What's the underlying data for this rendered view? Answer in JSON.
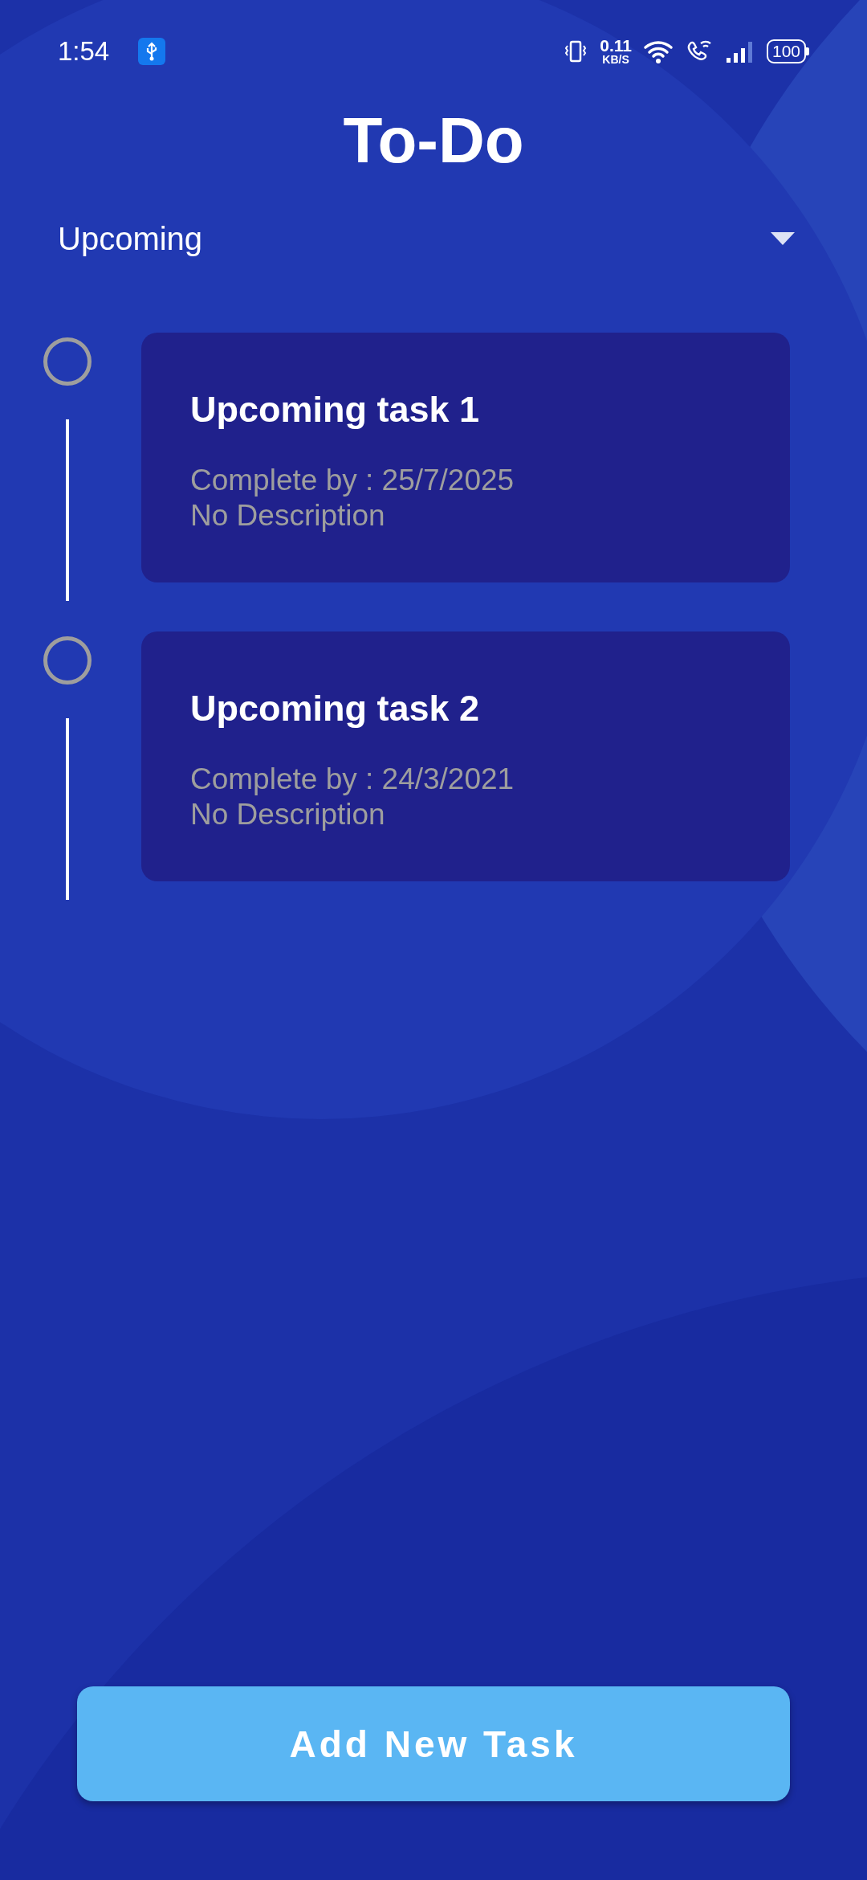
{
  "status_bar": {
    "time": "1:54",
    "net_speed": "0.11",
    "net_unit": "KB/S",
    "battery": "100"
  },
  "title": "To-Do",
  "filter": {
    "label": "Upcoming"
  },
  "tasks": [
    {
      "title": "Upcoming task 1",
      "due": "Complete by : 25/7/2025",
      "description": "No Description",
      "completed": false
    },
    {
      "title": "Upcoming task 2",
      "due": "Complete by : 24/3/2021",
      "description": "No Description",
      "completed": false
    }
  ],
  "add_button": "Add New Task"
}
